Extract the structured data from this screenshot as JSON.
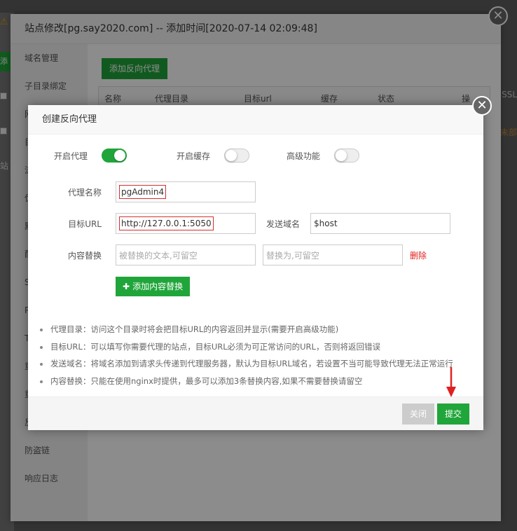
{
  "background": {
    "left_fragments": [
      "添",
      "站"
    ],
    "right_fragments": [
      "SSL",
      "未部"
    ]
  },
  "site_modal": {
    "title": "站点修改[pg.say2020.com] -- 添加时间[2020-07-14 02:09:48]",
    "close_glyph": "✕",
    "sidebar": [
      "域名管理",
      "子目录绑定",
      "网",
      "目",
      "流",
      "伪",
      "默",
      "配",
      "S",
      "P",
      "T",
      "重",
      "重",
      "反",
      "防盗链",
      "响应日志"
    ],
    "add_proxy_label": "添加反向代理",
    "table_headers": [
      "名称",
      "代理目录",
      "目标url",
      "缓存",
      "状态",
      "操"
    ]
  },
  "dialog": {
    "title": "创建反向代理",
    "close_glyph": "✕",
    "enable_proxy_label": "开启代理",
    "enable_proxy_on": true,
    "enable_cache_label": "开启缓存",
    "enable_cache_on": false,
    "advanced_label": "高级功能",
    "advanced_on": false,
    "proxy_name_label": "代理名称",
    "proxy_name_value": "pgAdmin4",
    "target_url_label": "目标URL",
    "target_url_value": "http://127.0.0.1:5050",
    "send_domain_label": "发送域名",
    "send_domain_value": "$host",
    "content_replace_label": "内容替换",
    "replace_from_placeholder": "被替换的文本,可留空",
    "replace_to_placeholder": "替换为,可留空",
    "delete_label": "删除",
    "add_replace_label": "添加内容替换",
    "notes": [
      "代理目录：访问这个目录时将会把目标URL的内容返回并显示(需要开启高级功能)",
      "目标URL：可以填写你需要代理的站点，目标URL必须为可正常访问的URL，否则将返回错误",
      "发送域名：将域名添加到请求头传递到代理服务器，默认为目标URL域名，若设置不当可能导致代理无法正常运行",
      "内容替换：只能在使用nginx时提供，最多可以添加3条替换内容,如果不需要替换请留空"
    ],
    "close_button": "关闭",
    "submit_button": "提交"
  },
  "colors": {
    "accent_green": "#20a53a",
    "delete_red": "#e02020",
    "highlight_red": "#d32f2f"
  }
}
